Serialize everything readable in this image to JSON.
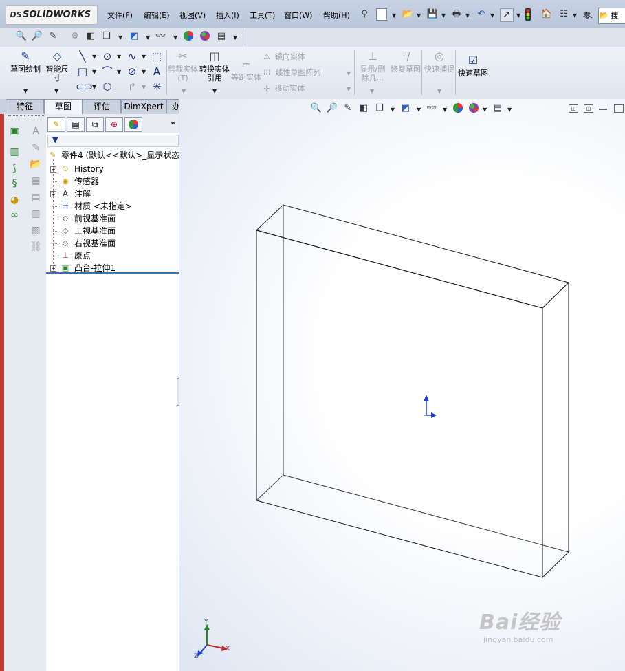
{
  "app": {
    "logo_text": "SOLIDWORKS",
    "logo_mark": "DS"
  },
  "menu": {
    "items": [
      "文件(F)",
      "编辑(E)",
      "视图(V)",
      "插入(I)",
      "工具(T)",
      "窗口(W)",
      "帮助(H)"
    ],
    "part_label": "零.",
    "search_text": "搜"
  },
  "command_manager": {
    "sketch_button": "草图绘制",
    "smart_dim_button": "智能尺寸",
    "trim_button": "剪裁实体(T)",
    "convert_button": "转换实体引用",
    "offset_button": "等距实体",
    "mirror_label": "镜向实体",
    "linear_pattern_label": "线性草图阵列",
    "move_label": "移动实体",
    "show_delete_button": "显示/删除几...",
    "repair_button": "修复草图",
    "quick_snap_button": "快速捕捉",
    "rapid_sketch_button": "快速草图"
  },
  "tabs": [
    "特征",
    "草图",
    "评估",
    "DimXpert",
    "办公室产品"
  ],
  "active_tab": "草图",
  "feature_tree": {
    "root_label": "零件4  (默认<<默认>_显示状态",
    "items": [
      {
        "label": "History",
        "icon": "history-folder-icon",
        "expandable": true
      },
      {
        "label": "传感器",
        "icon": "sensor-icon",
        "expandable": false
      },
      {
        "label": "注解",
        "icon": "annotation-icon",
        "expandable": true
      },
      {
        "label": "材质 <未指定>",
        "icon": "material-icon",
        "expandable": false
      },
      {
        "label": "前视基准面",
        "icon": "plane-icon",
        "expandable": false
      },
      {
        "label": "上视基准面",
        "icon": "plane-icon",
        "expandable": false
      },
      {
        "label": "右视基准面",
        "icon": "plane-icon",
        "expandable": false
      },
      {
        "label": "原点",
        "icon": "origin-icon",
        "expandable": false
      },
      {
        "label": "凸台-拉伸1",
        "icon": "extrude-icon",
        "expandable": true
      }
    ],
    "more_label": "»"
  },
  "triad": {
    "x": "X",
    "y": "Y",
    "z": "Z"
  },
  "watermark": {
    "main": "Bai经验",
    "sub": "jingyan.baidu.com"
  },
  "colors": {
    "menubar": "#bfcadc",
    "logo_red": "#c2382c",
    "origin_blue": "#1d3fd0",
    "model_edge": "#1a1a1a"
  }
}
